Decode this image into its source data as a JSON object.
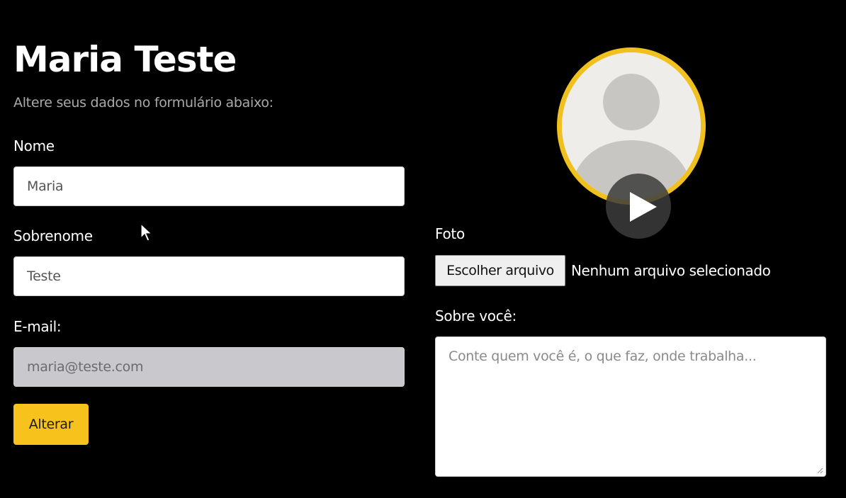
{
  "profile": {
    "title": "Maria Teste",
    "subtitle": "Altere seus dados no formulário abaixo:"
  },
  "form": {
    "first_name": {
      "label": "Nome",
      "value": "Maria"
    },
    "last_name": {
      "label": "Sobrenome",
      "value": "Teste"
    },
    "email": {
      "label": "E-mail:",
      "value": "maria@teste.com",
      "disabled": true
    },
    "submit_label": "Alterar"
  },
  "photo": {
    "label": "Foto",
    "choose_file_label": "Escolher arquivo",
    "file_status": "Nenhum arquivo selecionado"
  },
  "about": {
    "label": "Sobre você:",
    "placeholder": "Conte quem você é, o que faz, onde trabalha..."
  },
  "icons": {
    "avatar": "default-user-avatar-icon",
    "play": "play-icon",
    "cursor": "mouse-pointer-icon"
  },
  "colors": {
    "background": "#000000",
    "accent": "#f6c21b",
    "avatar_ring": "#f0c01e",
    "subtitle": "#a9a9a9",
    "disabled_input": "#c9c8cc"
  }
}
